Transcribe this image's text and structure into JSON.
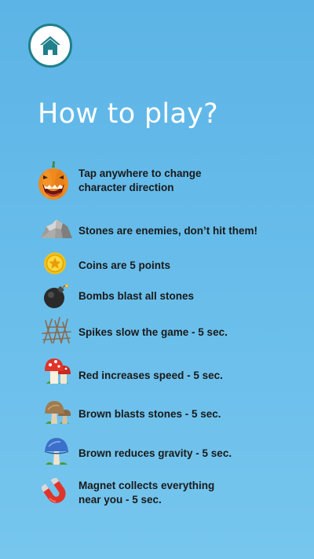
{
  "title": "How to play?",
  "home_button": {
    "icon": "home-icon"
  },
  "rules": [
    {
      "icon": "pumpkin-character-icon",
      "text": "Tap anywhere to change\ncharacter direction"
    },
    {
      "icon": "stone-icon",
      "text": "Stones are enemies, don’t hit them!"
    },
    {
      "icon": "coin-icon",
      "text": "Coins are 5 points"
    },
    {
      "icon": "bomb-icon",
      "text": "Bombs blast all stones"
    },
    {
      "icon": "spikes-icon",
      "text": "Spikes slow the game - 5 sec."
    },
    {
      "icon": "red-mushroom-icon",
      "text": "Red increases speed - 5 sec."
    },
    {
      "icon": "brown-mushroom-icon",
      "text": "Brown blasts stones - 5 sec."
    },
    {
      "icon": "blue-mushroom-icon",
      "text": "Brown reduces gravity - 5 sec."
    },
    {
      "icon": "magnet-icon",
      "text": "Magnet collects everything\nnear you - 5 sec."
    }
  ],
  "colors": {
    "background": "#66bbe9",
    "home_icon": "#1f7f8b",
    "text": "#1a1a1a",
    "title": "#ffffff"
  }
}
